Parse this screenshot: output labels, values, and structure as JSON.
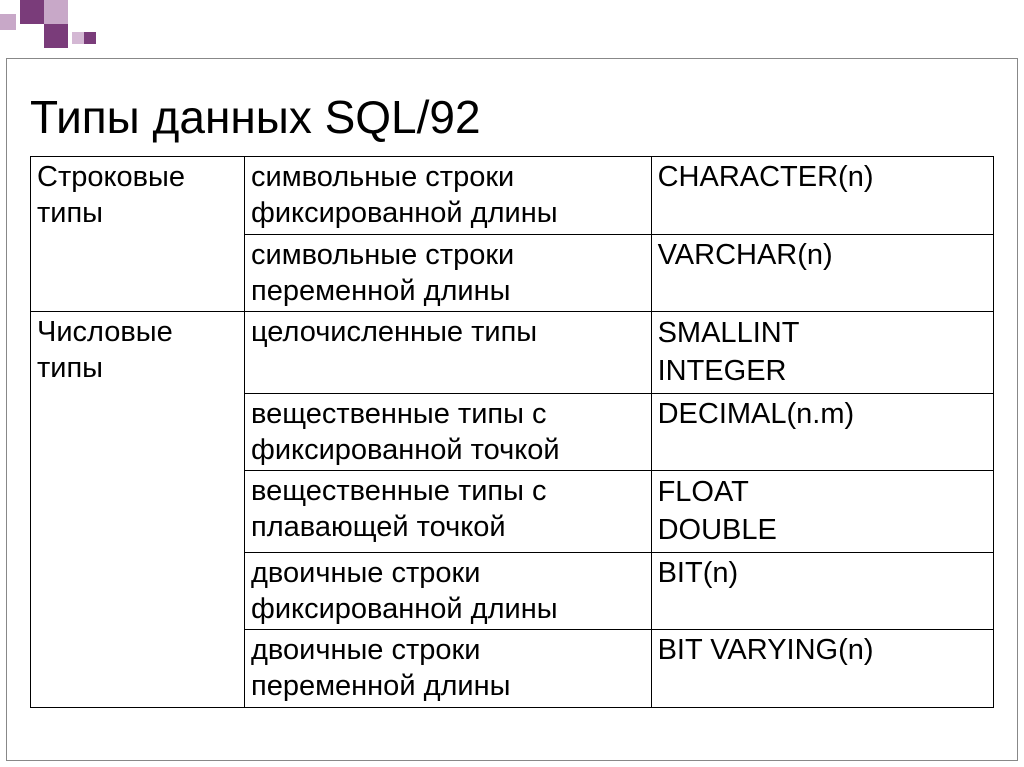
{
  "title": "Типы данных SQL/92",
  "rows": [
    {
      "category": "Строковые типы",
      "description": "символьные строки фиксированной длины",
      "types": [
        "CHARACTER(n)"
      ]
    },
    {
      "category": "",
      "description": "символьные строки переменной длины",
      "types": [
        "VARCHAR(n)"
      ]
    },
    {
      "category": "Числовые типы",
      "description": "целочисленные типы",
      "types": [
        "SMALLINT",
        "INTEGER"
      ]
    },
    {
      "category": "",
      "description": "вещественные типы с фиксированной точкой",
      "types": [
        "DECIMAL(n.m)"
      ]
    },
    {
      "category": "",
      "description": "вещественные типы с плавающей точкой",
      "types": [
        "FLOAT",
        "DOUBLE"
      ]
    },
    {
      "category": "",
      "description": "двоичные строки фиксированной длины",
      "types": [
        "BIT(n)"
      ]
    },
    {
      "category": "",
      "description": "двоичные строки переменной длины",
      "types": [
        "BIT VARYING(n)"
      ]
    }
  ]
}
